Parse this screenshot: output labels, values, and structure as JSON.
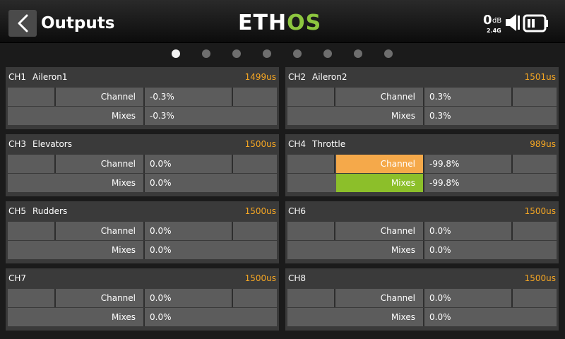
{
  "header": {
    "back_icon": "chevron-left-icon",
    "title": "Outputs",
    "logo_eth": "ETH",
    "logo_os": "OS",
    "rssi_value": "0",
    "rssi_unit": "dB",
    "rssi_band": "2.4G",
    "speaker_icon": "speaker-icon",
    "battery_icon": "battery-icon"
  },
  "pager": {
    "total": 8,
    "active": 1
  },
  "colors": {
    "accent_value": "#f5a623",
    "channel_bar": "#f5a94a",
    "mixes_bar": "#8cbf2a",
    "logo_green": "#8dc63f"
  },
  "labels": {
    "channel": "Channel",
    "mixes": "Mixes"
  },
  "channels": [
    {
      "id": "CH1",
      "name": "Aileron1",
      "us": "1499us",
      "channel_pct": "-0.3%",
      "mixes_pct": "-0.3%",
      "channel_fraction": -0.003,
      "mixes_fraction": -0.003
    },
    {
      "id": "CH2",
      "name": "Aileron2",
      "us": "1501us",
      "channel_pct": "0.3%",
      "mixes_pct": "0.3%",
      "channel_fraction": 0.003,
      "mixes_fraction": 0.003
    },
    {
      "id": "CH3",
      "name": "Elevators",
      "us": "1500us",
      "channel_pct": "0.0%",
      "mixes_pct": "0.0%",
      "channel_fraction": 0.0,
      "mixes_fraction": 0.0
    },
    {
      "id": "CH4",
      "name": "Throttle",
      "us": "989us",
      "channel_pct": "-99.8%",
      "mixes_pct": "-99.8%",
      "channel_fraction": -0.998,
      "mixes_fraction": -0.998
    },
    {
      "id": "CH5",
      "name": "Rudders",
      "us": "1500us",
      "channel_pct": "0.0%",
      "mixes_pct": "0.0%",
      "channel_fraction": 0.0,
      "mixes_fraction": 0.0
    },
    {
      "id": "CH6",
      "name": "",
      "us": "1500us",
      "channel_pct": "0.0%",
      "mixes_pct": "0.0%",
      "channel_fraction": 0.0,
      "mixes_fraction": 0.0
    },
    {
      "id": "CH7",
      "name": "",
      "us": "1500us",
      "channel_pct": "0.0%",
      "mixes_pct": "0.0%",
      "channel_fraction": 0.0,
      "mixes_fraction": 0.0
    },
    {
      "id": "CH8",
      "name": "",
      "us": "1500us",
      "channel_pct": "0.0%",
      "mixes_pct": "0.0%",
      "channel_fraction": 0.0,
      "mixes_fraction": 0.0
    }
  ]
}
